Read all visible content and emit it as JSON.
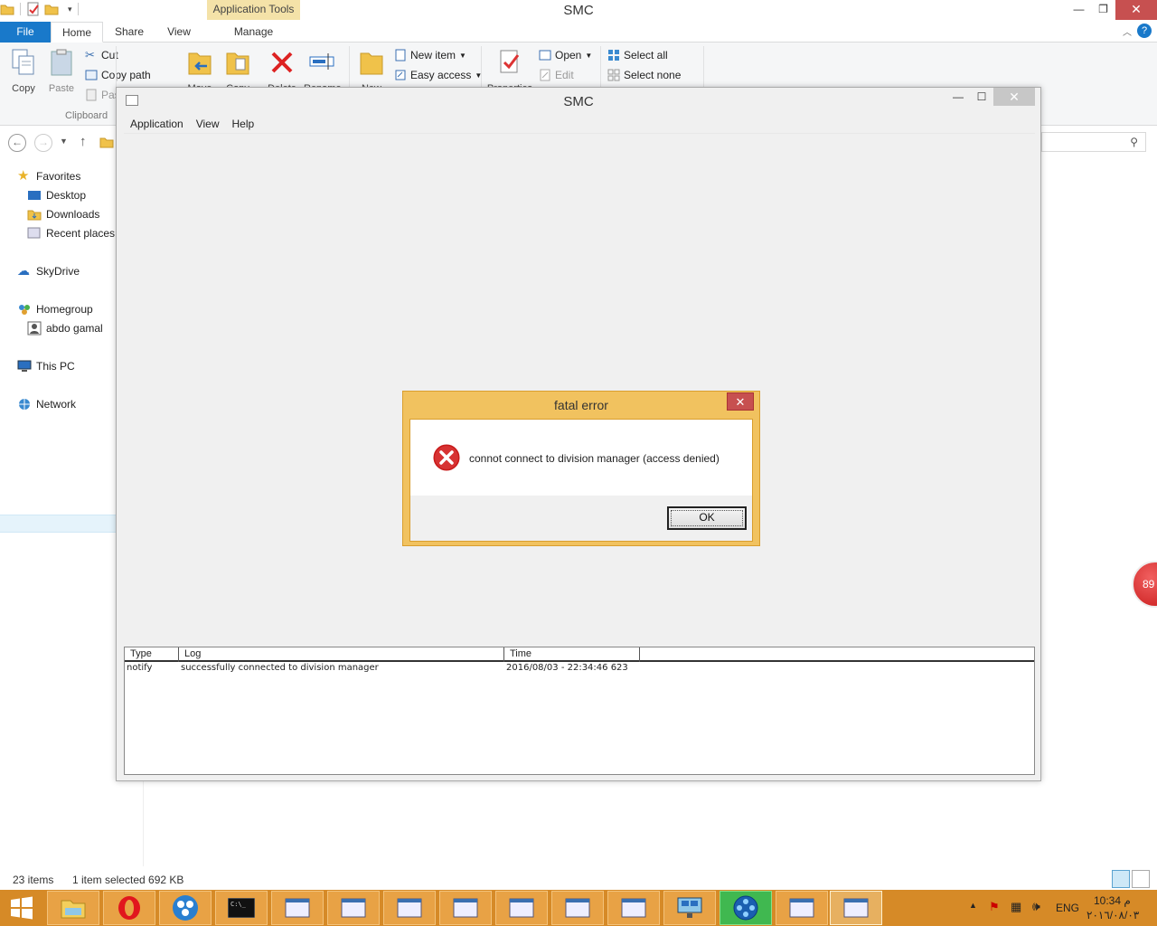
{
  "explorer": {
    "title": "SMC",
    "contextual_tab": "Application Tools",
    "tabs": [
      "File",
      "Home",
      "Share",
      "View",
      "Manage"
    ],
    "ribbon": {
      "copy": "Copy",
      "paste": "Paste",
      "cut": "Cut",
      "copy_path": "Copy path",
      "paste_shortcut": "Pas",
      "clipboard_group": "Clipboard",
      "move_to": "Move",
      "copy_to": "Copy",
      "delete": "Delete",
      "rename": "Rename",
      "new_folder": "New",
      "new_item": "New item",
      "easy_access": "Easy access",
      "properties": "Properties",
      "open": "Open",
      "edit": "Edit",
      "select_all": "Select all",
      "select_none": "Select none"
    },
    "nav": {
      "favorites": "Favorites",
      "desktop": "Desktop",
      "downloads": "Downloads",
      "recent_places": "Recent places",
      "skydrive": "SkyDrive",
      "homegroup": "Homegroup",
      "user": "abdo gamal",
      "this_pc": "This PC",
      "network": "Network"
    },
    "status": {
      "items": "23 items",
      "selected": "1 item selected  692 KB"
    }
  },
  "smc": {
    "title": "SMC",
    "menu": [
      "Application",
      "View",
      "Help"
    ],
    "log": {
      "columns": [
        "Type",
        "Log",
        "Time"
      ],
      "rows": [
        {
          "type": "notify",
          "log": "successfully connected to division manager",
          "time": "2016/08/03 - 22:34:46 623"
        }
      ]
    }
  },
  "dialog": {
    "title": "fatal error",
    "message": "connot connect to division manager (access denied)",
    "ok": "OK",
    "close": "✕"
  },
  "badge": "89",
  "tray": {
    "lang": "ENG",
    "time": "10:34 م",
    "date": "٢٠١٦/٠٨/٠٣"
  },
  "colors": {
    "taskbar": "#d68a27",
    "dialog_frame": "#f1c25f",
    "file_tab": "#1979ca",
    "close_red": "#c75050"
  }
}
